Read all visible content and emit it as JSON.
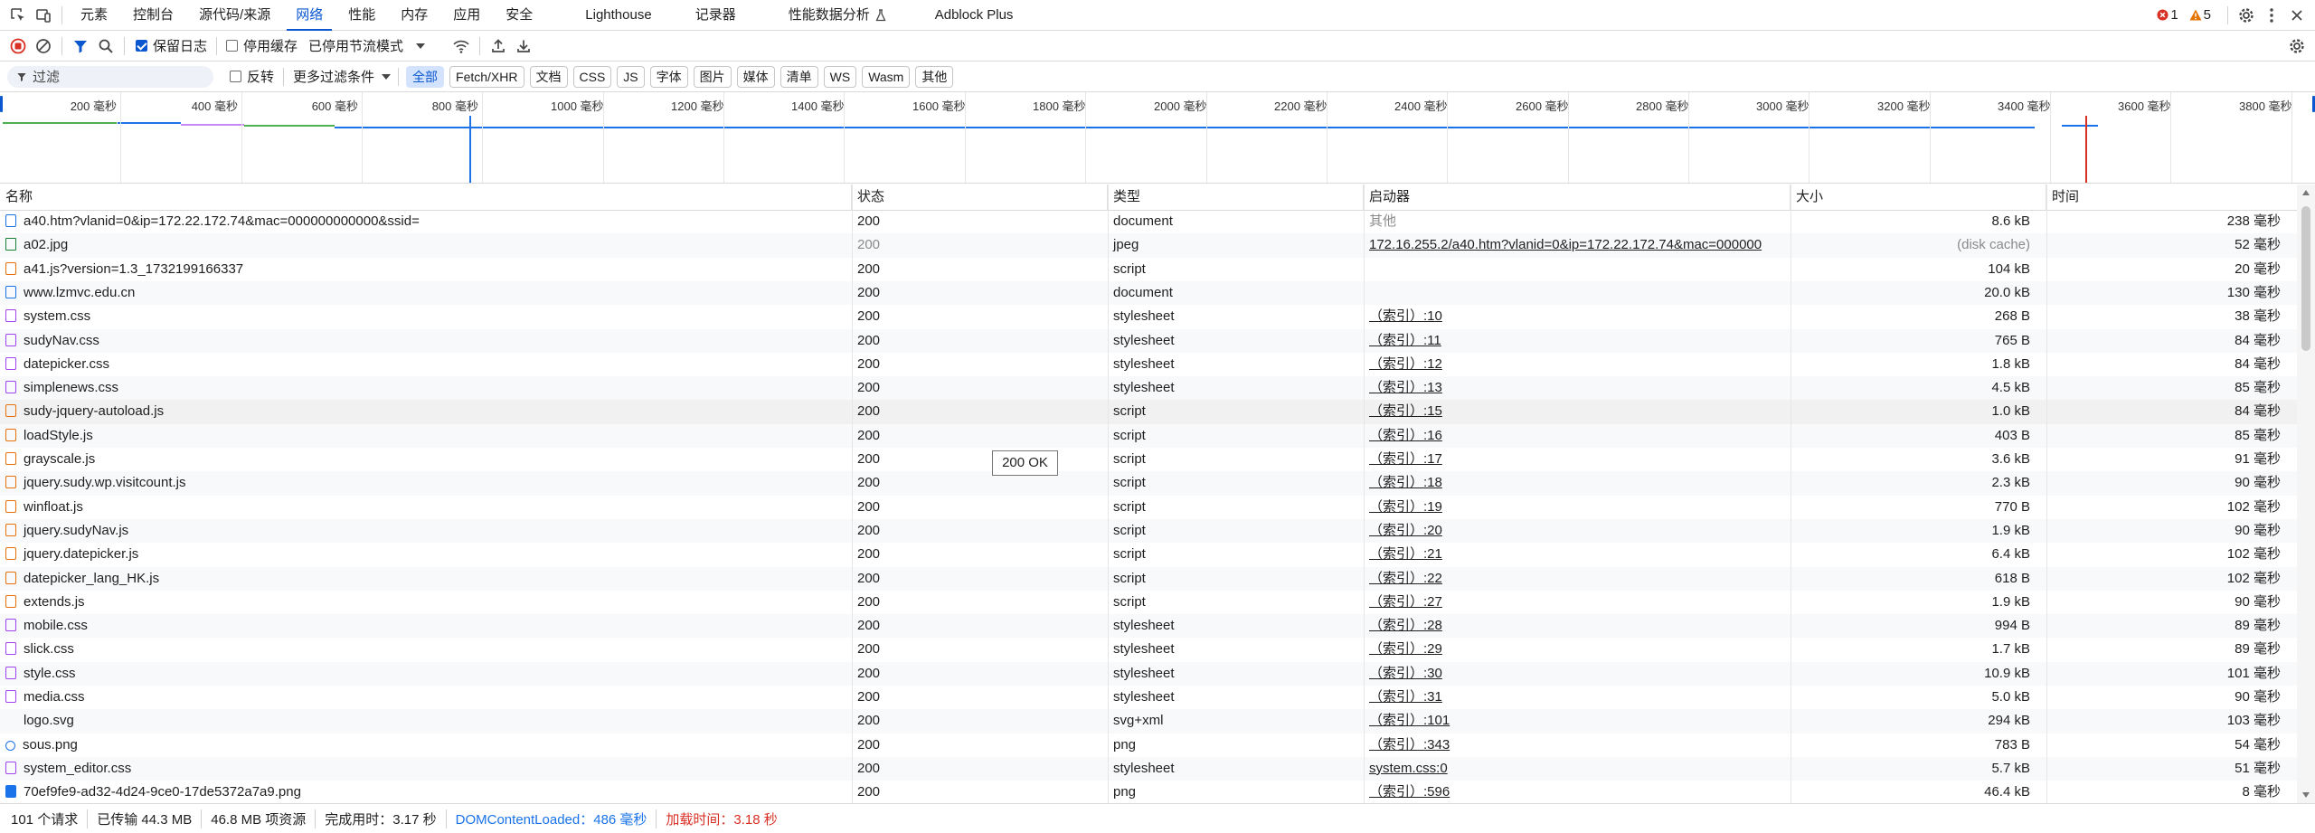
{
  "tabbar": {
    "tabs": [
      "元素",
      "控制台",
      "源代码/来源",
      "网络",
      "性能",
      "内存",
      "应用",
      "安全",
      "Lighthouse",
      "记录器",
      "性能数据分析",
      "Adblock Plus"
    ],
    "active_tab": "网络",
    "error_count": "1",
    "warning_count": "5"
  },
  "toolbar1": {
    "preserve_log": "保留日志",
    "disable_cache": "停用缓存",
    "throttle": "已停用节流模式"
  },
  "toolbar2": {
    "filter_placeholder": "过滤",
    "invert": "反转",
    "more_filters": "更多过滤条件",
    "chips": [
      "全部",
      "Fetch/XHR",
      "文档",
      "CSS",
      "JS",
      "字体",
      "图片",
      "媒体",
      "清单",
      "WS",
      "Wasm",
      "其他"
    ]
  },
  "overview": {
    "ticks": [
      "200 毫秒",
      "400 毫秒",
      "600 毫秒",
      "800 毫秒",
      "1000 毫秒",
      "1200 毫秒",
      "1400 毫秒",
      "1600 毫秒",
      "1800 毫秒",
      "2000 毫秒",
      "2200 毫秒",
      "2400 毫秒",
      "2600 毫秒",
      "2800 毫秒",
      "3000 毫秒",
      "3200 毫秒",
      "3400 毫秒",
      "3600 毫秒",
      "3800 毫秒"
    ]
  },
  "columns": {
    "name": "名称",
    "status": "状态",
    "type": "类型",
    "initiator": "启动器",
    "size": "大小",
    "time": "时间"
  },
  "rows": [
    {
      "name": "a40.htm?vlanid=0&ip=172.22.172.74&mac=000000000000&ssid=",
      "status": "200",
      "type": "document",
      "initiator": "其他",
      "size": "8.6 kB",
      "time": "238 毫秒",
      "icon": "doc"
    },
    {
      "name": "a02.jpg",
      "status": "200",
      "type": "jpeg",
      "initiator": "172.16.255.2/a40.htm?vlanid=0&ip=172.22.172.74&mac=000000",
      "size": "(disk cache)",
      "time": "52 毫秒",
      "icon": "img"
    },
    {
      "name": "a41.js?version=1.3_1732199166337",
      "status": "200",
      "type": "script",
      "initiator": "",
      "size": "104 kB",
      "time": "20 毫秒",
      "icon": "script"
    },
    {
      "name": "www.lzmvc.edu.cn",
      "status": "200",
      "type": "document",
      "initiator": "",
      "size": "20.0 kB",
      "time": "130 毫秒",
      "icon": "doc"
    },
    {
      "name": "system.css",
      "status": "200",
      "type": "stylesheet",
      "initiator": "（索引）:10",
      "size": "268 B",
      "time": "38 毫秒",
      "icon": "css"
    },
    {
      "name": "sudyNav.css",
      "status": "200",
      "type": "stylesheet",
      "initiator": "（索引）:11",
      "size": "765 B",
      "time": "84 毫秒",
      "icon": "css"
    },
    {
      "name": "datepicker.css",
      "status": "200",
      "type": "stylesheet",
      "initiator": "（索引）:12",
      "size": "1.8 kB",
      "time": "84 毫秒",
      "icon": "css"
    },
    {
      "name": "simplenews.css",
      "status": "200",
      "type": "stylesheet",
      "initiator": "（索引）:13",
      "size": "4.5 kB",
      "time": "85 毫秒",
      "icon": "css"
    },
    {
      "name": "sudy-jquery-autoload.js",
      "status": "200",
      "type": "script",
      "initiator": "（索引）:15",
      "size": "1.0 kB",
      "time": "84 毫秒",
      "icon": "script"
    },
    {
      "name": "loadStyle.js",
      "status": "200",
      "type": "script",
      "initiator": "（索引）:16",
      "size": "403 B",
      "time": "85 毫秒",
      "icon": "script"
    },
    {
      "name": "grayscale.js",
      "status": "200",
      "type": "script",
      "initiator": "（索引）:17",
      "size": "3.6 kB",
      "time": "91 毫秒",
      "icon": "script"
    },
    {
      "name": "jquery.sudy.wp.visitcount.js",
      "status": "200",
      "type": "script",
      "initiator": "（索引）:18",
      "size": "2.3 kB",
      "time": "90 毫秒",
      "icon": "script"
    },
    {
      "name": "winfloat.js",
      "status": "200",
      "type": "script",
      "initiator": "（索引）:19",
      "size": "770 B",
      "time": "102 毫秒",
      "icon": "script"
    },
    {
      "name": "jquery.sudyNav.js",
      "status": "200",
      "type": "script",
      "initiator": "（索引）:20",
      "size": "1.9 kB",
      "time": "90 毫秒",
      "icon": "script"
    },
    {
      "name": "jquery.datepicker.js",
      "status": "200",
      "type": "script",
      "initiator": "（索引）:21",
      "size": "6.4 kB",
      "time": "102 毫秒",
      "icon": "script"
    },
    {
      "name": "datepicker_lang_HK.js",
      "status": "200",
      "type": "script",
      "initiator": "（索引）:22",
      "size": "618 B",
      "time": "102 毫秒",
      "icon": "script"
    },
    {
      "name": "extends.js",
      "status": "200",
      "type": "script",
      "initiator": "（索引）:27",
      "size": "1.9 kB",
      "time": "90 毫秒",
      "icon": "script"
    },
    {
      "name": "mobile.css",
      "status": "200",
      "type": "stylesheet",
      "initiator": "（索引）:28",
      "size": "994 B",
      "time": "89 毫秒",
      "icon": "css"
    },
    {
      "name": "slick.css",
      "status": "200",
      "type": "stylesheet",
      "initiator": "（索引）:29",
      "size": "1.7 kB",
      "time": "89 毫秒",
      "icon": "css"
    },
    {
      "name": "style.css",
      "status": "200",
      "type": "stylesheet",
      "initiator": "（索引）:30",
      "size": "10.9 kB",
      "time": "101 毫秒",
      "icon": "css"
    },
    {
      "name": "media.css",
      "status": "200",
      "type": "stylesheet",
      "initiator": "（索引）:31",
      "size": "5.0 kB",
      "time": "90 毫秒",
      "icon": "css"
    },
    {
      "name": "logo.svg",
      "status": "200",
      "type": "svg+xml",
      "initiator": "（索引）:101",
      "size": "294 kB",
      "time": "103 毫秒",
      "icon": "none"
    },
    {
      "name": "sous.png",
      "status": "200",
      "type": "png",
      "initiator": "（索引）:343",
      "size": "783 B",
      "time": "54 毫秒",
      "icon": "search"
    },
    {
      "name": "system_editor.css",
      "status": "200",
      "type": "stylesheet",
      "initiator": "system.css:0",
      "size": "5.7 kB",
      "time": "51 毫秒",
      "icon": "css"
    },
    {
      "name": "70ef9fe9-ad32-4d24-9ce0-17de5372a7a9.png",
      "status": "200",
      "type": "png",
      "initiator": "（索引）:596",
      "size": "46.4 kB",
      "time": "8 毫秒",
      "icon": "blue"
    }
  ],
  "tooltip": "200 OK",
  "status_bar": {
    "requests": "101 个请求",
    "transferred": "已传输 44.3 MB",
    "resources": "46.8 MB 项资源",
    "finish": "完成用时：3.17 秒",
    "dom": "DOMContentLoaded：486 毫秒",
    "load": "加载时间：3.18 秒"
  },
  "colors": {
    "accent": "#0b57d0",
    "dom_line": "#1a73e8",
    "load_line": "#d93025"
  }
}
